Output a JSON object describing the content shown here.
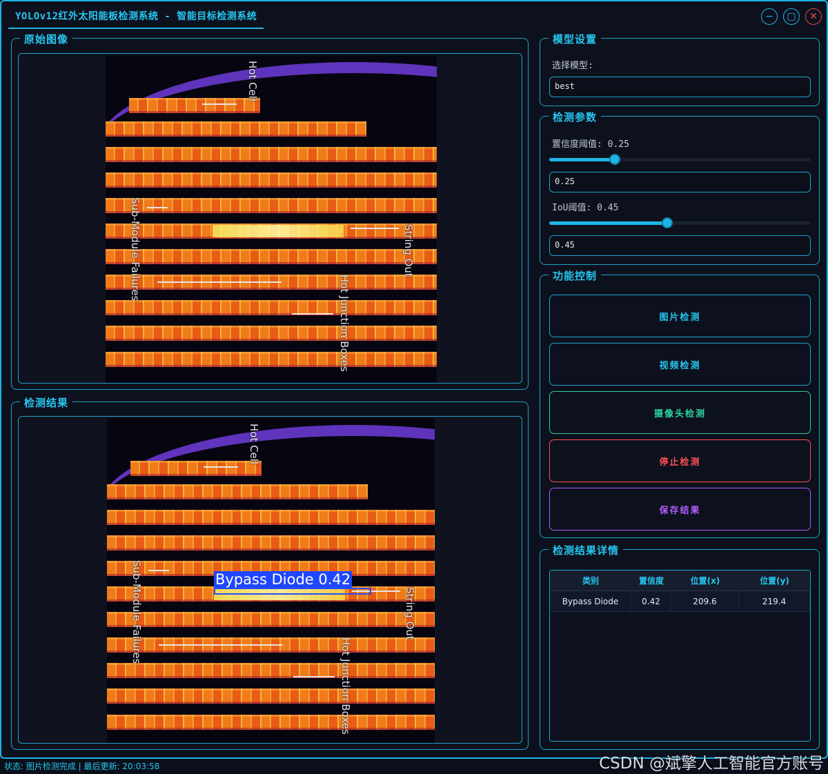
{
  "window": {
    "title": "YOLOv12红外太阳能板检测系统 - 智能目标检测系统",
    "minimize_icon": "minimize-icon",
    "maximize_icon": "maximize-icon",
    "close_icon": "close-icon"
  },
  "original": {
    "title": "原始图像",
    "annotations": [
      "Hot Cell",
      "Sub-Module Failures",
      "String Out",
      "Hot Junction Boxes"
    ]
  },
  "result": {
    "title": "检测结果",
    "detection_label": "Bypass  Diode  0.42",
    "annotations": [
      "Hot Cell",
      "Sub-Module Failures",
      "String Out",
      "Hot Junction Boxes"
    ]
  },
  "model": {
    "title": "模型设置",
    "select_label": "选择模型:",
    "selected": "best"
  },
  "params": {
    "title": "检测参数",
    "conf_label": "置信度阈值: 0.25",
    "conf_value": "0.25",
    "conf_level": 0.25,
    "iou_label": "IoU阈值: 0.45",
    "iou_value": "0.45",
    "iou_level": 0.45
  },
  "controls": {
    "title": "功能控制",
    "image_btn": "图片检测",
    "video_btn": "视频检测",
    "camera_btn": "摄像头检测",
    "stop_btn": "停止检测",
    "save_btn": "保存结果",
    "colors": {
      "image": "#27c6f0",
      "video": "#27c6f0",
      "camera": "#2ed3a0",
      "stop": "#ff5050",
      "save": "#b35cff"
    }
  },
  "details": {
    "title": "检测结果详情",
    "columns": [
      "类别",
      "置信度",
      "位置(x)",
      "位置(y)"
    ],
    "rows": [
      [
        "Bypass Diode",
        "0.42",
        "209.6",
        "219.4"
      ]
    ]
  },
  "status": "状态: 图片检测完成 | 最后更新: 20:03:58",
  "watermark": "CSDN @斌擎人工智能官方账号"
}
